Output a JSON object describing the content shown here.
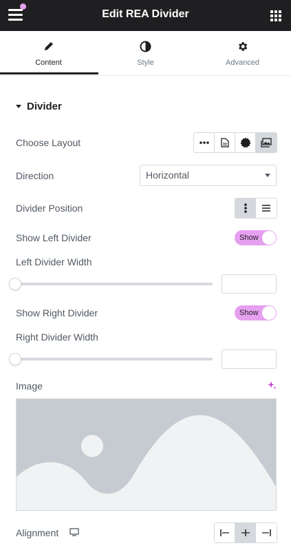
{
  "header": {
    "title": "Edit REA Divider"
  },
  "tabs": [
    {
      "label": "Content",
      "icon": "pencil-icon",
      "active": true
    },
    {
      "label": "Style",
      "icon": "half-circle-icon",
      "active": false
    },
    {
      "label": "Advanced",
      "icon": "gear-icon",
      "active": false
    }
  ],
  "section": {
    "title": "Divider"
  },
  "choose_layout": {
    "label": "Choose Layout",
    "options": [
      "dots-icon",
      "document-icon",
      "badge-icon",
      "image-icon"
    ],
    "selected_index": 3
  },
  "direction": {
    "label": "Direction",
    "value": "Horizontal"
  },
  "divider_position": {
    "label": "Divider Position",
    "options": [
      "vertical-dots-icon",
      "horizontal-lines-icon"
    ],
    "selected_index": 0
  },
  "show_left_divider": {
    "label": "Show Left Divider",
    "toggle_text": "Show",
    "on": true
  },
  "left_divider_width": {
    "label": "Left Divider Width",
    "value": "",
    "slider_fraction": 0
  },
  "show_right_divider": {
    "label": "Show Right Divider",
    "toggle_text": "Show",
    "on": true
  },
  "right_divider_width": {
    "label": "Right Divider Width",
    "value": "",
    "slider_fraction": 0
  },
  "image": {
    "label": "Image"
  },
  "alignment": {
    "label": "Alignment",
    "options": [
      "align-left-icon",
      "align-center-icon",
      "align-right-icon"
    ],
    "selected_index": 1
  },
  "colors": {
    "header_bg": "#1f1f21",
    "accent_pink": "#e6a0f0",
    "ai_purple": "#c03fcf",
    "placeholder_bg": "#c5cbd0",
    "placeholder_shape": "#f1f2f3"
  }
}
